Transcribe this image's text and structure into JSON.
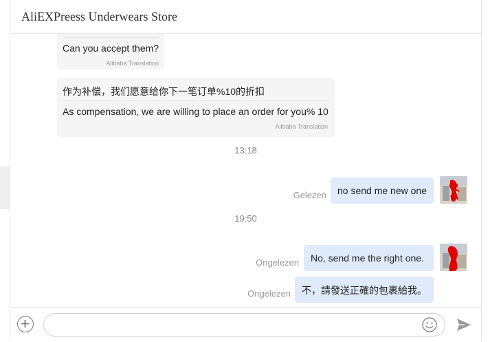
{
  "header": {
    "store_title": "AliEXPreess Underwears Store"
  },
  "messages": {
    "incoming_1": {
      "text": "Can you accept them?",
      "translation_label": "Alibaba Translation"
    },
    "incoming_2": {
      "original": "作为补偿，我们愿意给你下一笔订单%10的折扣",
      "translated": "As compensation, we are willing to place an order for you% 10",
      "translation_label": "Alibaba Translation"
    },
    "time_1": "13:18",
    "outgoing_1": {
      "text": "no send me new one",
      "status": "Gelezen"
    },
    "time_2": "19:50",
    "outgoing_2": {
      "text": "No, send me the right one.",
      "status": "Ongelezen"
    },
    "outgoing_3": {
      "text": "不，請發送正確的包裹給我。",
      "status": "Ongelezen"
    }
  },
  "composer": {
    "placeholder": "",
    "value": ""
  },
  "colors": {
    "incoming_bubble": "#f5f5f5",
    "outgoing_bubble": "#dfeafb",
    "avatar_scribble": "#e00000"
  },
  "icons": {
    "add": "plus-circle-icon",
    "emoji": "smiley-icon",
    "send": "send-arrow-icon"
  }
}
